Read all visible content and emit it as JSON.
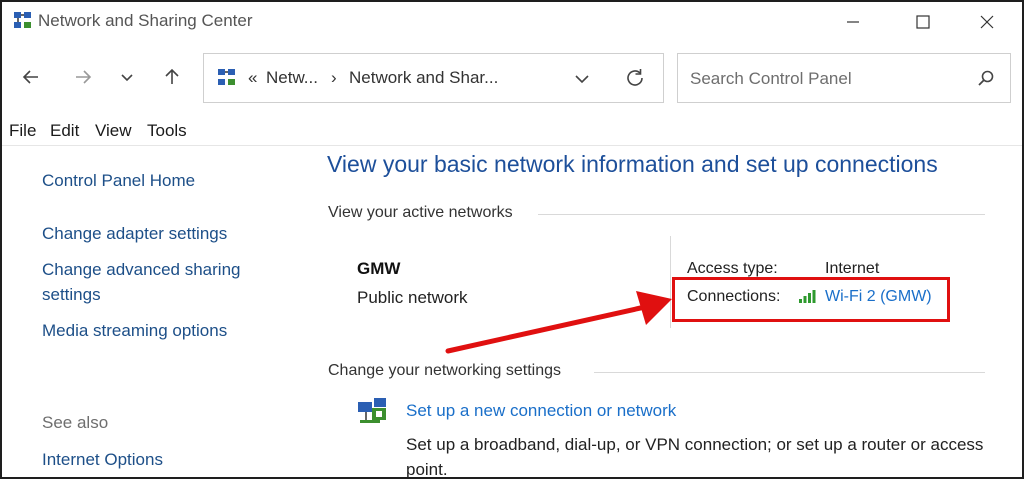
{
  "window": {
    "title": "Network and Sharing Center",
    "minimize_label": "—",
    "maximize_label": "☐",
    "close_label": "✕"
  },
  "nav": {
    "back_icon": "←",
    "forward_icon": "→",
    "recent_icon": "⌄",
    "up_icon": "↑",
    "address": {
      "overflow": "«",
      "crumb1": "Netw...",
      "separator": "›",
      "crumb2": "Network and Shar...",
      "dropdown_icon": "⌄",
      "refresh_icon": "↻"
    },
    "search_placeholder": "Search Control Panel"
  },
  "menu": [
    "File",
    "Edit",
    "View",
    "Tools"
  ],
  "sidebar": {
    "home": "Control Panel Home",
    "links": [
      "Change adapter settings",
      "Change advanced sharing settings",
      "Media streaming options"
    ],
    "see_also_label": "See also",
    "see_also_links": [
      "Internet Options"
    ]
  },
  "main": {
    "heading": "View your basic network information and set up connections",
    "active_networks_title": "View your active networks",
    "network": {
      "name": "GMW",
      "type": "Public network",
      "access_type_label": "Access type:",
      "access_type_value": "Internet",
      "connections_label": "Connections:",
      "connection_name": "Wi-Fi 2 (GMW)"
    },
    "change_settings_title": "Change your networking settings",
    "setup": {
      "link": "Set up a new connection or network",
      "description": "Set up a broadband, dial-up, or VPN connection; or set up a router or access point."
    }
  },
  "annotation": {
    "color": "#e01010"
  },
  "colors": {
    "link": "#1a6fc9",
    "heading": "#1d4f9a",
    "left_link": "#1d4f88"
  }
}
